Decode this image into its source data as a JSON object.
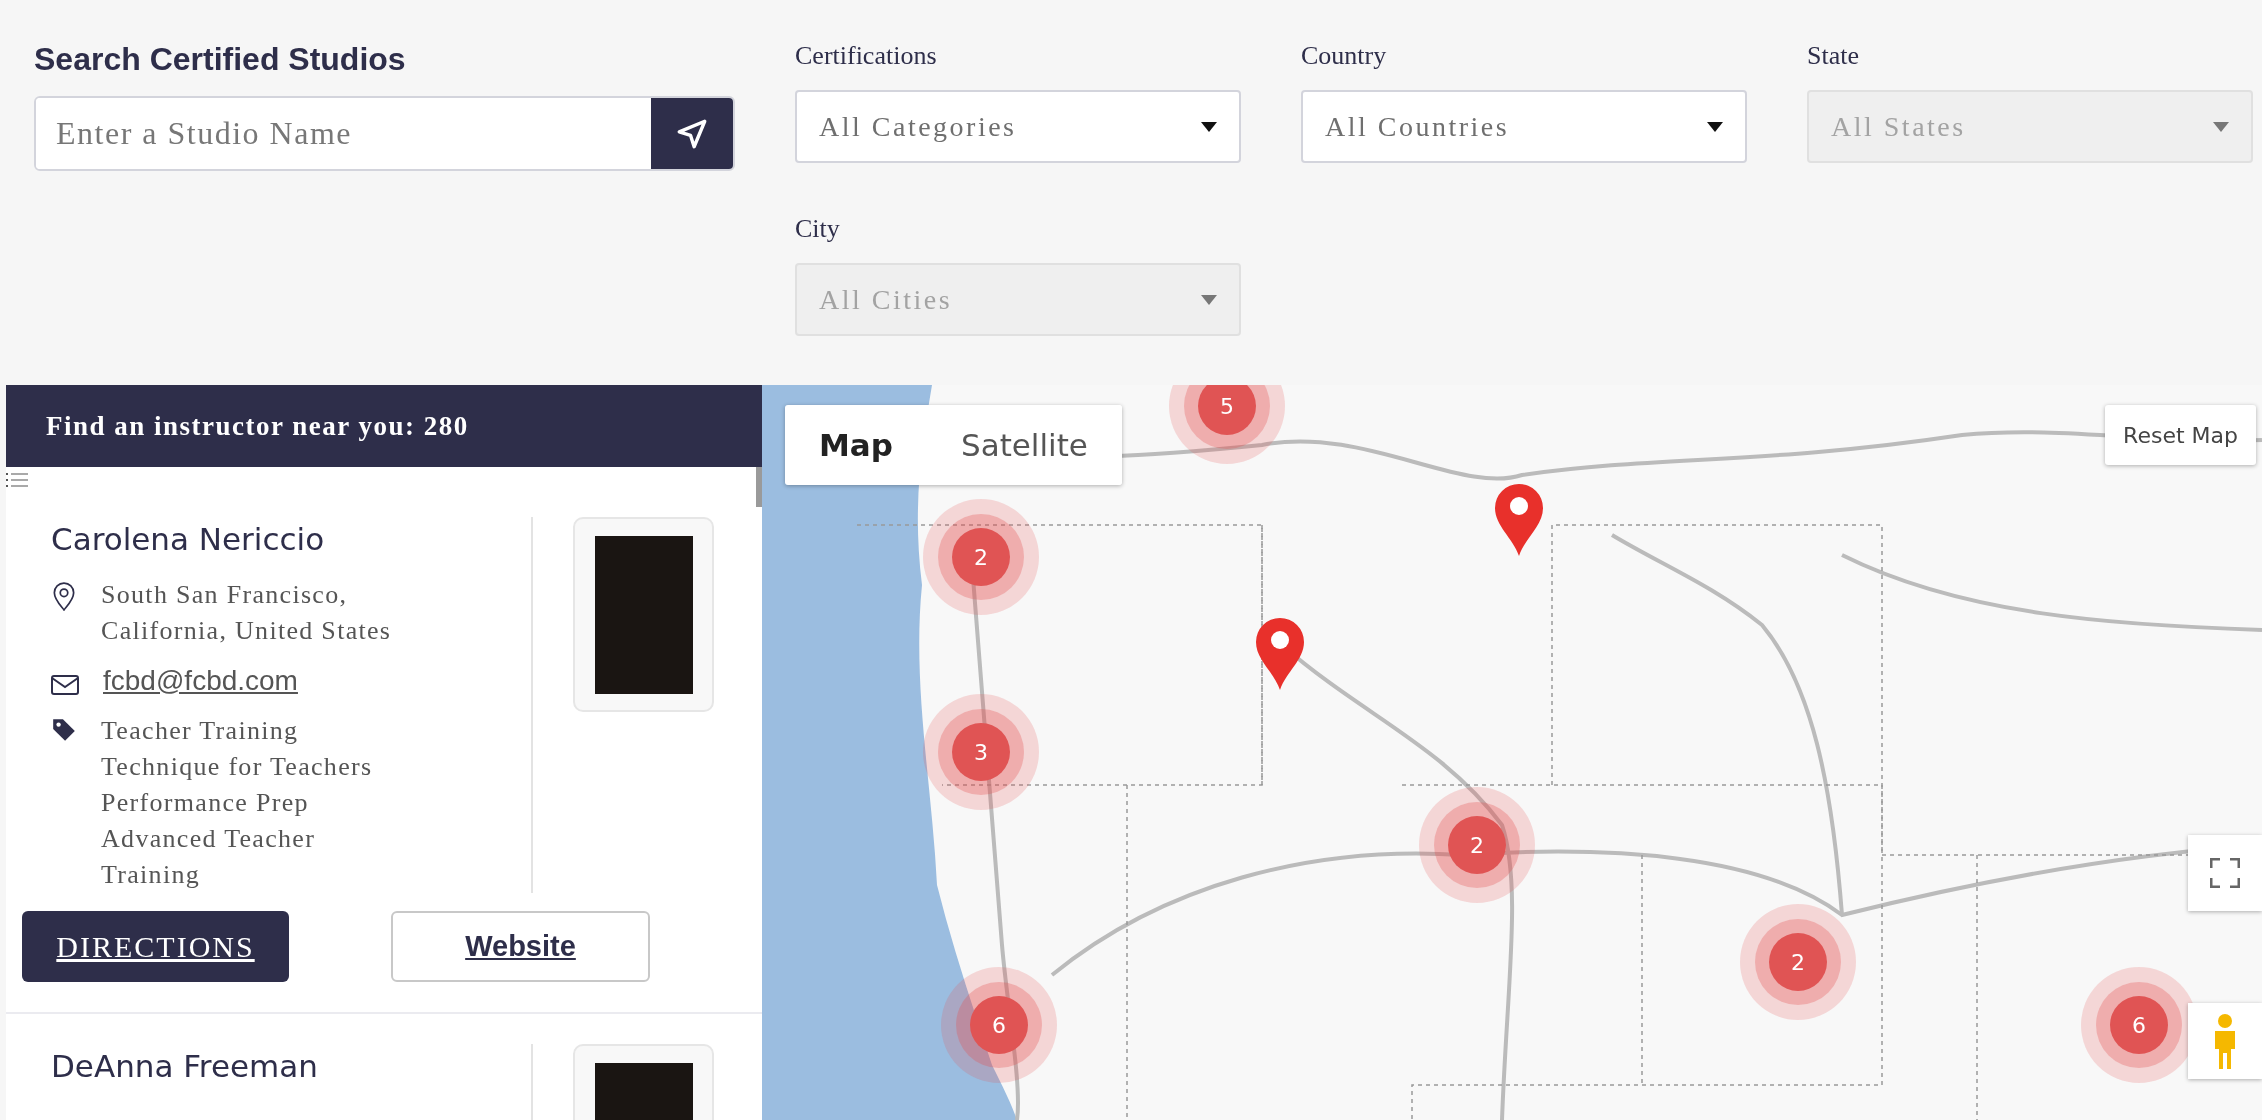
{
  "search": {
    "title": "Search Certified Studios",
    "placeholder": "Enter a Studio Name"
  },
  "filters": [
    {
      "label": "Certifications",
      "value": "All Categories",
      "disabled": false
    },
    {
      "label": "Country",
      "value": "All Countries",
      "disabled": false
    },
    {
      "label": "State",
      "value": "All States",
      "disabled": true
    },
    {
      "label": "City",
      "value": "All Cities",
      "disabled": true
    }
  ],
  "results": {
    "heading": "Find an instructor near you: 280",
    "instructors": [
      {
        "name": "Carolena Nericcio",
        "location": "South San Francisco, California, United States",
        "email": "fcbd@fcbd.com",
        "certifications": [
          "Teacher Training",
          "Technique for Teachers",
          "Performance Prep",
          "Advanced Teacher Training"
        ],
        "buttons": [
          {
            "label": "DIRECTIONS",
            "kind": "primary"
          },
          {
            "label": "Website",
            "kind": "outline"
          }
        ]
      },
      {
        "name": "DeAnna Freeman"
      }
    ]
  },
  "map": {
    "map_types": [
      {
        "label": "Map",
        "selected": true
      },
      {
        "label": "Satellite",
        "selected": false
      }
    ],
    "reset_label": "Reset Map",
    "clusters": [
      {
        "count": "5"
      },
      {
        "count": "2"
      },
      {
        "count": "3"
      },
      {
        "count": "2"
      },
      {
        "count": "6"
      },
      {
        "count": "2"
      },
      {
        "count": "6"
      }
    ]
  }
}
